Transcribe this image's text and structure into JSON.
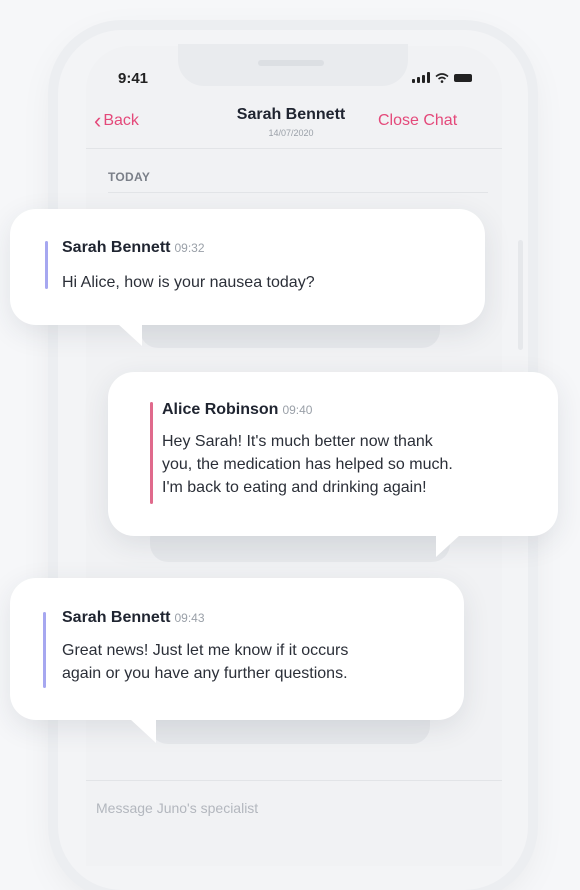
{
  "status_bar": {
    "time": "9:41"
  },
  "nav": {
    "back_label": "Back",
    "title": "Sarah Bennett",
    "subtitle": "14/07/2020",
    "close_label": "Close Chat"
  },
  "day_separator": "TODAY",
  "messages": [
    {
      "sender": "Sarah Bennett",
      "time": "09:32",
      "lines": [
        "Hi Alice, how is your nausea today?"
      ]
    },
    {
      "sender": "Alice Robinson",
      "time": "09:40",
      "lines": [
        "Hey Sarah! It's much better now thank",
        "you, the medication has helped so much.",
        "I'm back to eating and drinking again!"
      ]
    },
    {
      "sender": "Sarah Bennett",
      "time": "09:43",
      "lines": [
        "Great news! Just let me know if it occurs",
        "again or you have any further questions."
      ]
    }
  ],
  "composer": {
    "placeholder": "Message Juno's specialist"
  },
  "colors": {
    "accent": "#e4497a",
    "specialist_bar": "#a6a7f0",
    "patient_bar": "#e06a8c"
  }
}
